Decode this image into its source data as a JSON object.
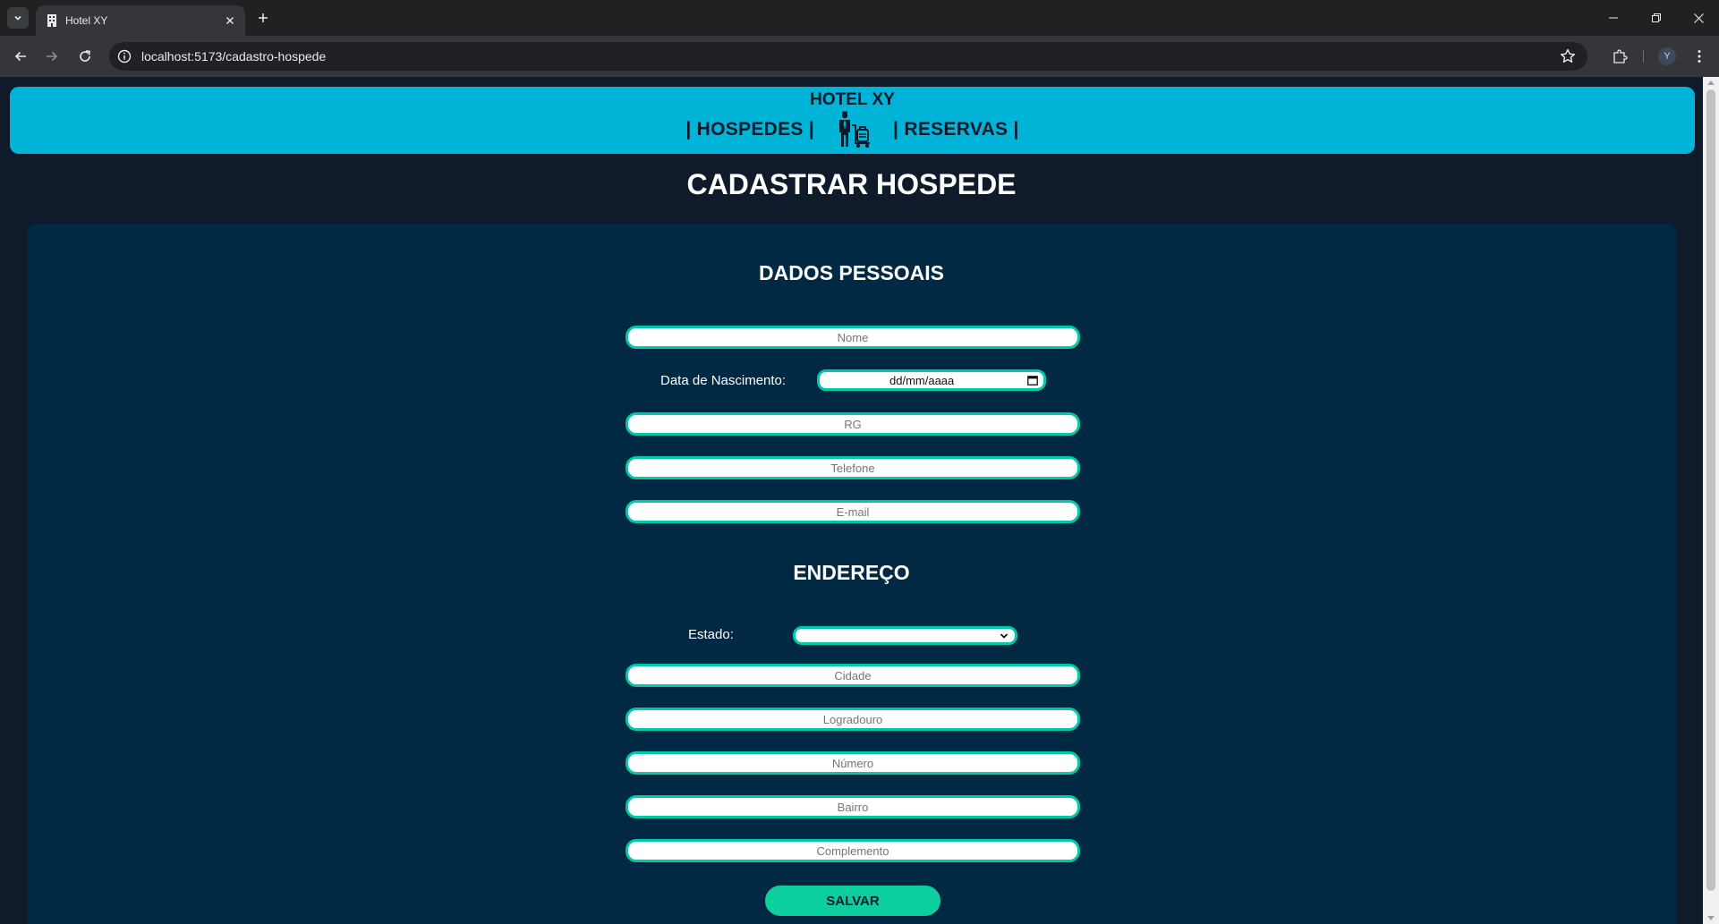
{
  "browser": {
    "tab_title": "Hotel XY",
    "url": "localhost:5173/cadastro-hospede",
    "profile_initial": "Y"
  },
  "header": {
    "brand": "HOTEL XY",
    "nav_hospedes": "| HOSPEDES |",
    "nav_reservas": "| RESERVAS |",
    "nav_icon": "bellhop-luggage-icon"
  },
  "page": {
    "title": "CADASTRAR HOSPEDE"
  },
  "personal": {
    "section_title": "DADOS PESSOAIS",
    "nome_placeholder": "Nome",
    "birth_label": "Data de Nascimento:",
    "birth_value": "dd/mm/aaaa",
    "rg_placeholder": "RG",
    "telefone_placeholder": "Telefone",
    "email_placeholder": "E-mail"
  },
  "address": {
    "section_title": "ENDEREÇO",
    "estado_label": "Estado:",
    "estado_value": "",
    "cidade_placeholder": "Cidade",
    "logradouro_placeholder": "Logradouro",
    "numero_placeholder": "Número",
    "bairro_placeholder": "Bairro",
    "complemento_placeholder": "Complemento"
  },
  "actions": {
    "save_label": "SALVAR"
  },
  "colors": {
    "header_bg": "#00b4d8",
    "card_bg": "#022944",
    "page_bg": "#0f1a2a",
    "input_border": "#00c9a7",
    "button_bg": "#0bcf9e"
  }
}
